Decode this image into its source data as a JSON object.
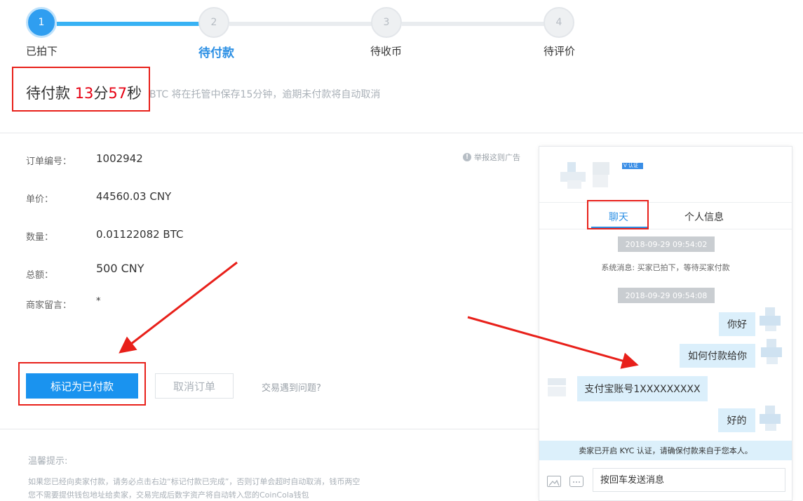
{
  "stepper": {
    "steps": [
      {
        "number": "1",
        "label": "已拍下"
      },
      {
        "number": "2",
        "label": "待付款"
      },
      {
        "number": "3",
        "label": "待收币"
      },
      {
        "number": "4",
        "label": "待评价"
      }
    ]
  },
  "countdown": {
    "prefix": "待付款",
    "minutes": "13",
    "minute_unit": "分",
    "seconds": "57",
    "second_unit": "秒",
    "hint": "BTC 将在托管中保存15分钟，逾期未付款将自动取消"
  },
  "order": {
    "fields": [
      {
        "label": "订单编号：",
        "value": "1002942"
      },
      {
        "label": "单价：",
        "value": "44560.03 CNY"
      },
      {
        "label": "数量：",
        "value": "0.01122082 BTC"
      },
      {
        "label": "总额：",
        "value": "500 CNY"
      },
      {
        "label": "商家留言：",
        "value": "*"
      }
    ],
    "report_label": "举报这则广告"
  },
  "actions": {
    "mark_paid": "标记为已付款",
    "cancel_order": "取消订单",
    "problem_link": "交易遇到问题?"
  },
  "tips": {
    "title": "温馨提示:",
    "lines": [
      "如果您已经向卖家付款，请务必点击右边“标记付款已完成”，否则订单会超时自动取消，钱币两空",
      "您不需要提供钱包地址给卖家，交易完成后数字资产将自动转入您的CoinCola钱包"
    ]
  },
  "chat": {
    "verified_badge": "V 认证",
    "tabs": [
      "聊天",
      "个人信息"
    ],
    "messages": {
      "time1": "2018-09-29 09:54:02",
      "system": "系统消息: 买家已拍下，等待买家付款",
      "time2": "2018-09-29 09:54:08",
      "m1": "你好",
      "m2": "如何付款给你",
      "m3": "支付宝账号1XXXXXXXXX",
      "m4": "好的"
    },
    "kyc_notice": "卖家已开启 KYC 认证，请确保付款来自于您本人。",
    "input_placeholder": "按回车发送消息"
  },
  "colors": {
    "accent": "#1a93ef",
    "countdown_red": "#e60012",
    "annotation_red": "#e8201a",
    "bubble_bg": "#dbeffb"
  }
}
